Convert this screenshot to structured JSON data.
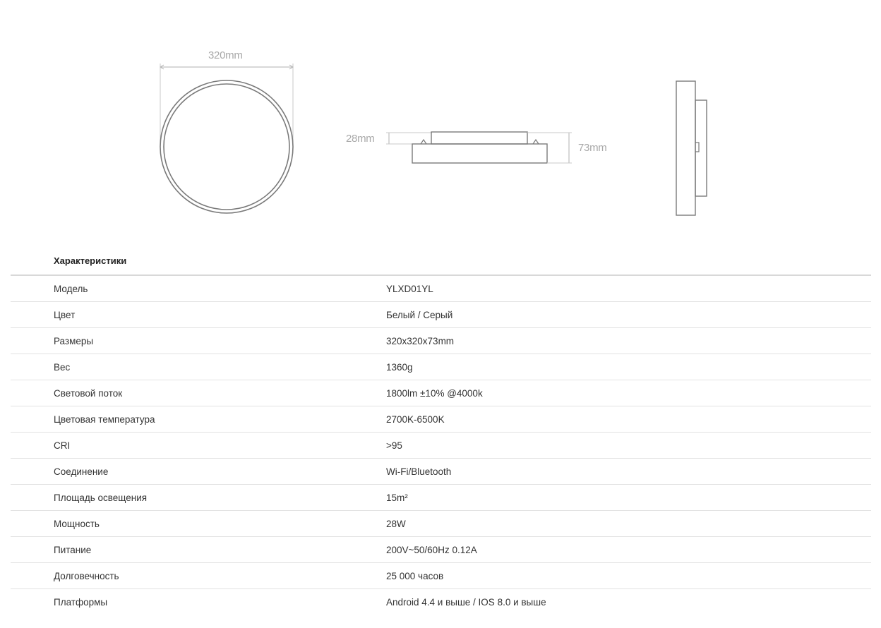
{
  "dimensions": {
    "diameter_label": "320mm",
    "base_height_label": "28mm",
    "total_height_label": "73mm"
  },
  "section_title": "Характеристики",
  "specs": [
    {
      "key": "Модель",
      "value": "YLXD01YL"
    },
    {
      "key": "Цвет",
      "value": "Белый / Серый"
    },
    {
      "key": "Размеры",
      "value": "320x320x73mm"
    },
    {
      "key": "Вес",
      "value": "1360g"
    },
    {
      "key": "Световой поток",
      "value": "1800lm ±10% @4000k"
    },
    {
      "key": "Цветовая температура",
      "value": "2700K-6500K"
    },
    {
      "key": "CRI",
      "value": ">95"
    },
    {
      "key": "Соединение",
      "value": "Wi-Fi/Bluetooth"
    },
    {
      "key": "Площадь освещения",
      "value": "15m²"
    },
    {
      "key": "Мощность",
      "value": "28W"
    },
    {
      "key": "Питание",
      "value": "200V~50/60Hz 0.12A"
    },
    {
      "key": "Долговечность",
      "value": "25 000 часов"
    },
    {
      "key": "Платформы",
      "value": "Android 4.4 и выше / IOS 8.0 и выше"
    }
  ],
  "colors": {
    "line": "#7a7a7a",
    "dim_line": "#b0b0b0",
    "dim_text": "#a8a8a8",
    "rule": "#e2e2e2"
  }
}
